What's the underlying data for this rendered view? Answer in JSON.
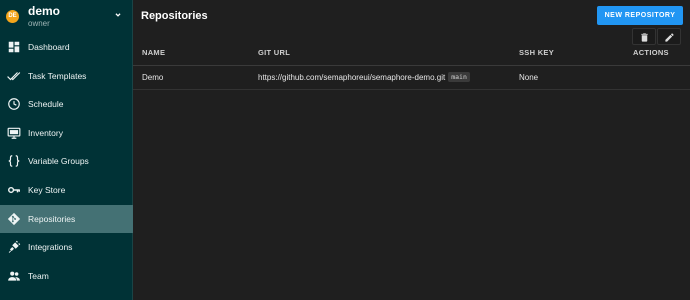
{
  "project": {
    "name": "demo",
    "role": "owner",
    "avatar_initials": "DE",
    "avatar_color": "#f3a51b"
  },
  "nav": {
    "items": [
      {
        "label": "Dashboard",
        "icon": "dashboard-icon"
      },
      {
        "label": "Task Templates",
        "icon": "double-check-icon"
      },
      {
        "label": "Schedule",
        "icon": "clock-icon"
      },
      {
        "label": "Inventory",
        "icon": "monitor-icon"
      },
      {
        "label": "Variable Groups",
        "icon": "braces-icon"
      },
      {
        "label": "Key Store",
        "icon": "key-icon"
      },
      {
        "label": "Repositories",
        "icon": "git-icon",
        "active": true
      },
      {
        "label": "Integrations",
        "icon": "plug-icon"
      },
      {
        "label": "Team",
        "icon": "people-icon"
      }
    ]
  },
  "page": {
    "title": "Repositories",
    "new_button": "NEW REPOSITORY"
  },
  "table": {
    "headers": {
      "name": "NAME",
      "git_url": "GIT URL",
      "ssh_key": "SSH KEY",
      "actions": "ACTIONS"
    },
    "rows": [
      {
        "name": "Demo",
        "git_url": "https://github.com/semaphoreui/semaphore-demo.git",
        "branch": "main",
        "ssh_key": "None"
      }
    ]
  },
  "colors": {
    "sidebar": "#003236",
    "sidebar_active": "#447174",
    "accent": "#2196f3",
    "background": "#1f1f1f"
  }
}
